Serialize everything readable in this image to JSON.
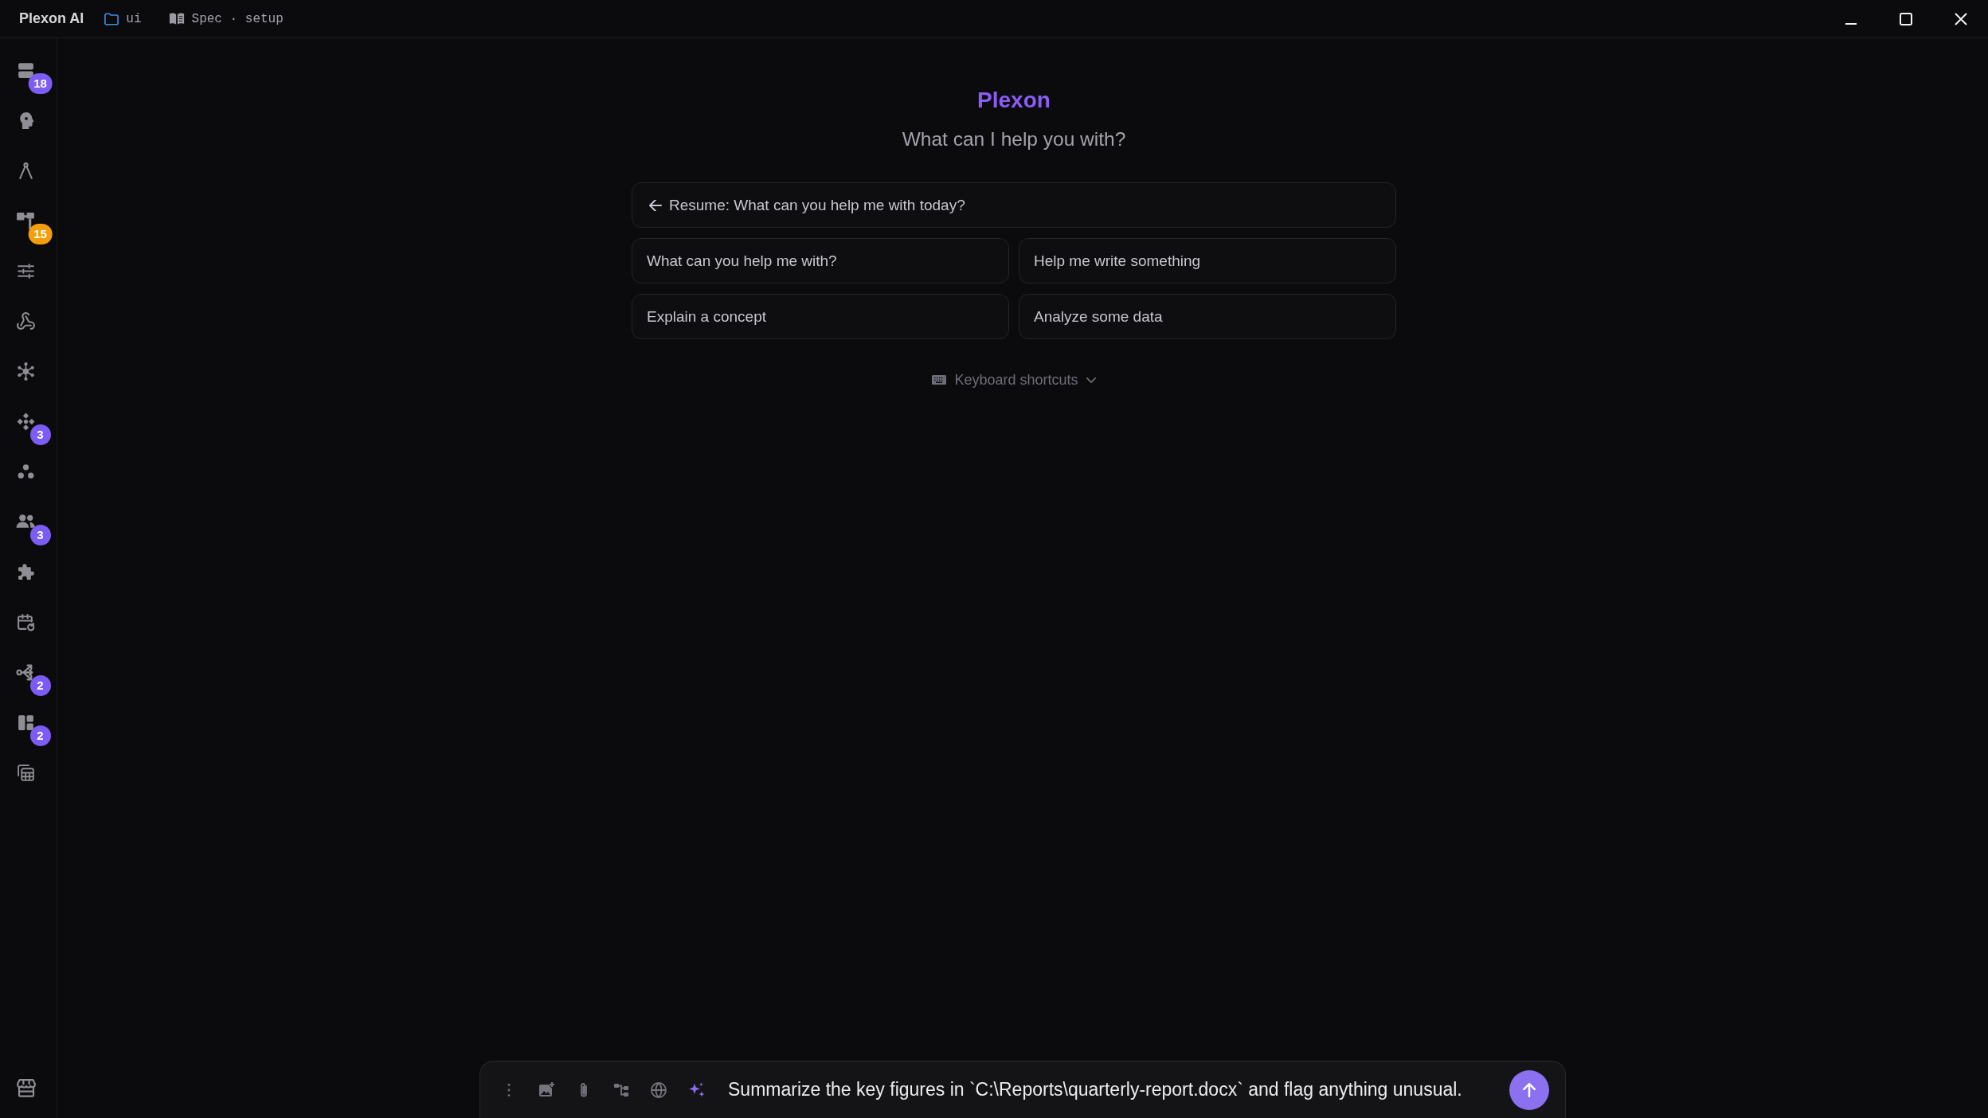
{
  "title_bar": {
    "app_name": "Plexon AI",
    "folder": "ui",
    "spec": "Spec · setup"
  },
  "sidebar": {
    "items": [
      {
        "kind": "stack",
        "badge": "18",
        "color": "#7c5cf4"
      },
      {
        "kind": "brain"
      },
      {
        "kind": "compass"
      },
      {
        "kind": "hierarchy",
        "badge": "15",
        "color": "#f59e0b"
      },
      {
        "kind": "sliders"
      },
      {
        "kind": "webhook"
      },
      {
        "kind": "network"
      },
      {
        "kind": "diamonds",
        "badge": "3",
        "color": "#7c5cf4"
      },
      {
        "kind": "circles"
      },
      {
        "kind": "people",
        "badge": "3",
        "color": "#7c5cf4"
      },
      {
        "kind": "puzzle"
      },
      {
        "kind": "calendar"
      },
      {
        "kind": "split",
        "badge": "2",
        "color": "#7c5cf4"
      },
      {
        "kind": "panels",
        "badge": "2",
        "color": "#7c5cf4"
      },
      {
        "kind": "grid"
      }
    ]
  },
  "heading": {
    "title": "Plexon",
    "subtitle": "What can I help you with?"
  },
  "resume": {
    "label": "Resume: What can you help me with today?"
  },
  "suggestions": [
    "What can you help me with?",
    "Help me write something",
    "Explain a concept",
    "Analyze some data"
  ],
  "shortcuts": {
    "label": "Keyboard shortcuts",
    "expanded": false
  },
  "composer": {
    "value": "Summarize the key figures in `C:\\Reports\\quarterly-report.docx` and flag anything unusual."
  }
}
